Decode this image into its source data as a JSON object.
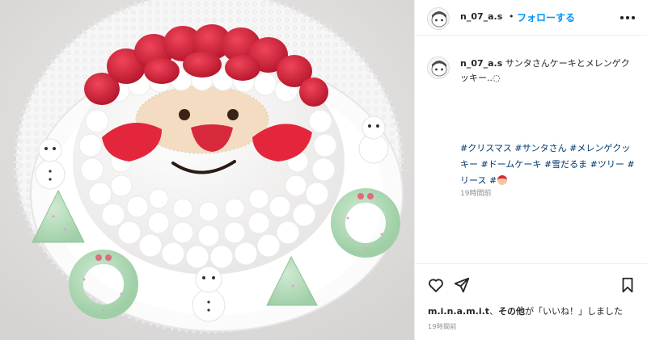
{
  "post": {
    "username": "n_07_a.s",
    "separator": "•",
    "follow_label": "フォローする",
    "more_icon": "more-horizontal-icon",
    "photo_alt": "サンタさんケーキ"
  },
  "caption": {
    "username": "n_07_a.s",
    "text": "サンタさんケーキとメレンゲクッキー..◌",
    "hashtags": [
      "#クリスマス",
      "#サンタさん",
      "#メレンゲクッキー",
      "#ドームケーキ",
      "#雪だるま",
      "#ツリー",
      "#リース",
      "#"
    ],
    "emoji": "santa-face-emoji",
    "time": "19時間前"
  },
  "actions": {
    "like_icon": "heart-icon",
    "share_icon": "paper-plane-icon",
    "save_icon": "bookmark-icon"
  },
  "likes": {
    "user": "m.i.n.a.m.i.t",
    "sep": "、",
    "others": "その他",
    "suffix": "が「いいね！」しました"
  },
  "timestamp": "19時間前",
  "colors": {
    "follow_blue": "#0095f6",
    "hashtag_navy": "#00376b",
    "muted_gray": "#8e8e8e",
    "text_dark": "#262626"
  }
}
